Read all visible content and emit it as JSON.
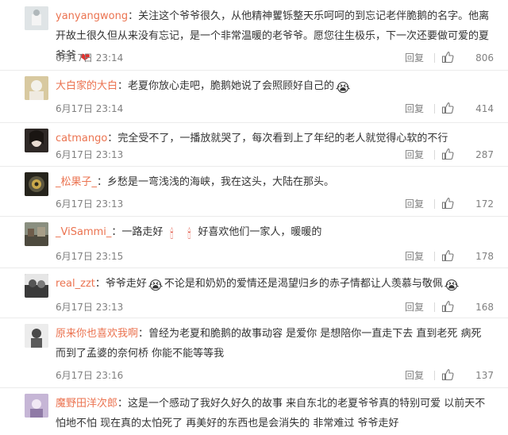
{
  "comments": [
    {
      "username": "yanyangwong",
      "text_a": "关注这个爷爷很久，从他精神矍铄整天乐呵呵的到忘记老伴脆鹅的名字。他离开故土很久但从来没有忘记，是一个非常温暖的老爷爷。愿您往生极乐，下一次还要做可爱的夏爷爷",
      "emoji_a": "❤",
      "time": "6月17日 23:14",
      "reply_label": "回复",
      "likes": "806",
      "avatar_color": "#cfd6d8"
    },
    {
      "username": "大白家的大白",
      "text_a": "老夏你放心走吧，脆鹅她说了会照顾好自己的",
      "emoji_a": "😭",
      "time": "6月17日 23:14",
      "reply_label": "回复",
      "likes": "414",
      "avatar_color": "#c9b98a"
    },
    {
      "username": "catmango",
      "text_a": "完全受不了，一播放就哭了，每次看到上了年纪的老人就觉得心软的不行",
      "time": "6月17日 23:13",
      "reply_label": "回复",
      "likes": "287",
      "avatar_color": "#3a3230"
    },
    {
      "username": "_松果子_",
      "text_a": "乡愁是一弯浅浅的海峡，我在这头，大陆在那头。",
      "time": "6月17日 23:13",
      "reply_label": "回复",
      "likes": "172",
      "avatar_color": "#2c2a22"
    },
    {
      "username": "_ViSammi_",
      "text_a": "一路走好",
      "emoji_a": "🕯",
      "emoji_b": "🕯",
      "text_b": "好喜欢他们一家人，暖暖的",
      "time": "6月17日 23:15",
      "reply_label": "回复",
      "likes": "178",
      "avatar_color": "#6b6a58"
    },
    {
      "username": "real_zzt",
      "text_a": "爷爷走好",
      "emoji_a": "😭",
      "text_b": "不论是和奶奶的爱情还是渴望归乡的赤子情都让人羡慕与敬佩",
      "emoji_b": "😭",
      "time": "6月17日 23:13",
      "reply_label": "回复",
      "likes": "168",
      "avatar_color": "#474747"
    },
    {
      "username": "原来你也喜欢我啊",
      "text_a": "曾经为老夏和脆鹅的故事动容 是爱你 是想陪你一直走下去 直到老死 病死 而到了孟婆的奈何桥 你能不能等等我",
      "time": "6月17日 23:16",
      "reply_label": "回复",
      "likes": "137",
      "avatar_color": "#dcdcdc"
    },
    {
      "username": "魔野田洋次郎",
      "text_a": "这是一个感动了我好久好久的故事 来自东北的老夏爷爷真的特别可爱 以前天不怕地不怕 现在真的太怕死了 再美好的东西也是会消失的 非常难过 爷爷走好",
      "time": "",
      "reply_label": "",
      "likes": "",
      "avatar_color": "#b9a9c9"
    }
  ]
}
